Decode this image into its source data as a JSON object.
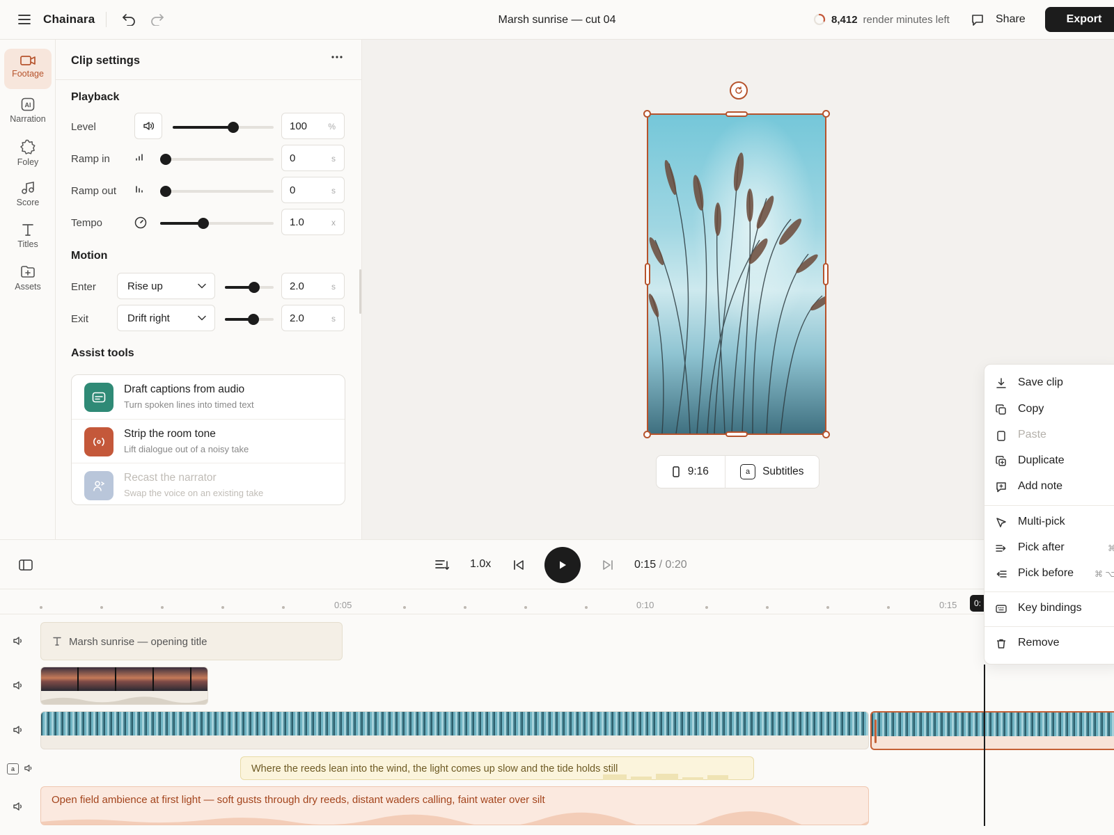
{
  "app": {
    "name": "Chainara",
    "document_title": "Marsh sunrise — cut 04"
  },
  "header": {
    "render_minutes": "8,412",
    "render_suffix": "render minutes left",
    "share_label": "Share",
    "export_label": "Export"
  },
  "rail": {
    "items": [
      {
        "label": "Footage",
        "icon": "video-camera-icon",
        "active": true
      },
      {
        "label": "Narration",
        "icon": "ai-voice-icon"
      },
      {
        "label": "Foley",
        "icon": "sound-burst-icon"
      },
      {
        "label": "Score",
        "icon": "music-note-icon"
      },
      {
        "label": "Titles",
        "icon": "text-icon"
      },
      {
        "label": "Assets",
        "icon": "folder-add-icon"
      }
    ]
  },
  "panel": {
    "title": "Clip settings",
    "playback": {
      "heading": "Playback",
      "level": {
        "label": "Level",
        "value": "100",
        "unit": "%",
        "slider": 0.61
      },
      "ramp_in": {
        "label": "Ramp in",
        "value": "0",
        "unit": "s",
        "slider": 0.0
      },
      "ramp_out": {
        "label": "Ramp out",
        "value": "0",
        "unit": "s",
        "slider": 0.0
      },
      "tempo": {
        "label": "Tempo",
        "value": "1.0",
        "unit": "x",
        "slider": 0.37
      }
    },
    "motion": {
      "heading": "Motion",
      "enter": {
        "label": "Enter",
        "option": "Rise up",
        "value": "2.0",
        "unit": "s",
        "slider": 0.63
      },
      "exit": {
        "label": "Exit",
        "option": "Drift right",
        "value": "2.0",
        "unit": "s",
        "slider": 0.61
      }
    },
    "assist": {
      "heading": "Assist tools",
      "items": [
        {
          "title": "Draft captions from audio",
          "subtitle": "Turn spoken lines into timed text",
          "color": "#2f8a76"
        },
        {
          "title": "Strip the room tone",
          "subtitle": "Lift dialogue out of a noisy take",
          "color": "#c4583a"
        },
        {
          "title": "Recast the narrator",
          "subtitle": "Swap the voice on an existing take",
          "color": "#b9c6da",
          "disabled": true
        }
      ]
    }
  },
  "preview": {
    "aspect": "9:16",
    "subtitles_label": "Subtitles",
    "subtitles_glyph": "a"
  },
  "context_menu": {
    "items": [
      {
        "label": "Save clip",
        "icon": "download-icon"
      },
      {
        "label": "Copy",
        "icon": "copy-icon"
      },
      {
        "label": "Paste",
        "icon": "clipboard-icon",
        "disabled": true
      },
      {
        "label": "Duplicate",
        "icon": "duplicate-icon"
      },
      {
        "label": "Add note",
        "icon": "note-icon"
      },
      {
        "label": "Multi-pick",
        "icon": "cursor-icon"
      },
      {
        "label": "Pick after",
        "icon": "pick-after-icon",
        "shortcut": "⌘"
      },
      {
        "label": "Pick before",
        "icon": "pick-before-icon",
        "shortcut": "⌘ ⌥"
      },
      {
        "label": "Key bindings",
        "icon": "keyboard-icon"
      },
      {
        "label": "Remove",
        "icon": "trash-icon"
      }
    ]
  },
  "transport": {
    "speed": "1.0x",
    "current": "0:15",
    "total": "/ 0:20"
  },
  "timeline": {
    "ticks": [
      "0:05",
      "0:10",
      "0:15"
    ],
    "playhead_badge": "0:",
    "title_clip": "Marsh sunrise — opening title",
    "subtitle_clip": "Where the reeds lean into the wind, the light comes up slow and the tide holds still",
    "ambience_clip": "Open field ambience at first light — soft gusts through dry reeds, distant waders calling, faint water over silt"
  },
  "colors": {
    "accent": "#b6532c",
    "dark": "#1c1c1c",
    "subtitle": "#fbf4dc",
    "ambience": "#fbe9df"
  }
}
